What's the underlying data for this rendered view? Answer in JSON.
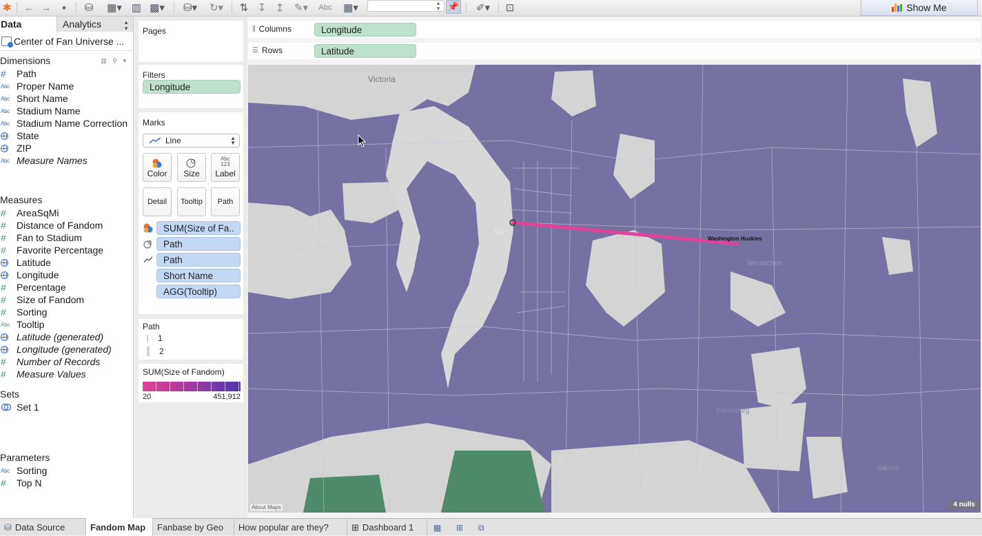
{
  "toolbar": {
    "abc_label": "Abc",
    "show_me": "Show Me",
    "show_me_colors": [
      "#e0442e",
      "#f2a33a",
      "#3b78d8",
      "#5a9e4b"
    ]
  },
  "data_pane": {
    "tab_data": "Data",
    "tab_analytics": "Analytics",
    "datasource": "Center of Fan Universe ...",
    "dimensions_title": "Dimensions",
    "dimensions": [
      {
        "icon": "hash",
        "label": "Path",
        "italic": false
      },
      {
        "icon": "abc",
        "label": "Proper Name",
        "italic": false
      },
      {
        "icon": "abc",
        "label": "Short Name",
        "italic": false
      },
      {
        "icon": "abc",
        "label": "Stadium Name",
        "italic": false
      },
      {
        "icon": "abc",
        "label": "Stadium Name Correction",
        "italic": false
      },
      {
        "icon": "globe",
        "label": "State",
        "italic": false
      },
      {
        "icon": "globe",
        "label": "ZIP",
        "italic": false
      },
      {
        "icon": "abc",
        "label": "Measure Names",
        "italic": true
      }
    ],
    "measures_title": "Measures",
    "measures": [
      {
        "icon": "hash",
        "label": "AreaSqMi",
        "italic": false
      },
      {
        "icon": "hash",
        "label": "Distance of Fandom",
        "italic": false
      },
      {
        "icon": "hash",
        "label": "Fan to Stadium",
        "italic": false
      },
      {
        "icon": "hash",
        "label": "Favorite Percentage",
        "italic": false
      },
      {
        "icon": "globe",
        "label": "Latitude",
        "italic": false
      },
      {
        "icon": "globe",
        "label": "Longitude",
        "italic": false
      },
      {
        "icon": "hash",
        "label": "Percentage",
        "italic": false
      },
      {
        "icon": "hash",
        "label": "Size of Fandom",
        "italic": false
      },
      {
        "icon": "hash",
        "label": "Sorting",
        "italic": false
      },
      {
        "icon": "abc",
        "label": "Tooltip",
        "italic": false
      },
      {
        "icon": "globe",
        "label": "Latitude (generated)",
        "italic": true
      },
      {
        "icon": "globe",
        "label": "Longitude (generated)",
        "italic": true
      },
      {
        "icon": "hash",
        "label": "Number of Records",
        "italic": true
      },
      {
        "icon": "hash",
        "label": "Measure Values",
        "italic": true
      }
    ],
    "sets_title": "Sets",
    "sets": [
      {
        "icon": "set",
        "label": "Set 1"
      }
    ],
    "parameters_title": "Parameters",
    "parameters": [
      {
        "icon": "abc",
        "label": "Sorting"
      },
      {
        "icon": "hash",
        "label": "Top N"
      }
    ]
  },
  "shelves": {
    "pages_title": "Pages",
    "filters_title": "Filters",
    "filter_pill": "Longitude",
    "columns_label": "Columns",
    "columns_pill": "Longitude",
    "rows_label": "Rows",
    "rows_pill": "Latitude"
  },
  "marks": {
    "title": "Marks",
    "mark_type": "Line",
    "buttons": {
      "color": "Color",
      "size": "Size",
      "label": "Label",
      "label_icon_top": "Abc",
      "label_icon_bottom": "123",
      "detail": "Detail",
      "tooltip": "Tooltip",
      "path": "Path"
    },
    "pills": [
      {
        "icon": "color",
        "label": "SUM(Size of Fa.."
      },
      {
        "icon": "size",
        "label": "Path"
      },
      {
        "icon": "path",
        "label": "Path"
      },
      {
        "icon": "none",
        "label": "Short Name"
      },
      {
        "icon": "none",
        "label": "AGG(Tooltip)"
      }
    ]
  },
  "path_legend": {
    "title": "Path",
    "items": [
      "1",
      "2"
    ]
  },
  "color_legend": {
    "title": "SUM(Size of Fandom)",
    "min": "20",
    "max": "451,912",
    "low_color": "#e0439a",
    "high_color": "#4a35a8"
  },
  "map": {
    "labels": {
      "victoria": "Victoria",
      "huskies": "Washington Huskies",
      "seattle_fragment": "Se",
      "wenatchee_fragment": "Wenatchee",
      "ellensburg_fragment": "Ellensburg",
      "yakima_fragment": "Yakima",
      "bend_fragment": "nd"
    },
    "about": "About Maps",
    "nulls": "4 nulls",
    "fill_color": "#7671a3",
    "line_color": "#e0439a"
  },
  "sheet_tabs": [
    {
      "label": "Data Source",
      "active": false
    },
    {
      "label": "Fandom Map",
      "active": true
    },
    {
      "label": "Fanbase by Geo",
      "active": false
    },
    {
      "label": "How popular are they?",
      "active": false
    },
    {
      "label": "Dashboard 1",
      "active": false
    }
  ]
}
